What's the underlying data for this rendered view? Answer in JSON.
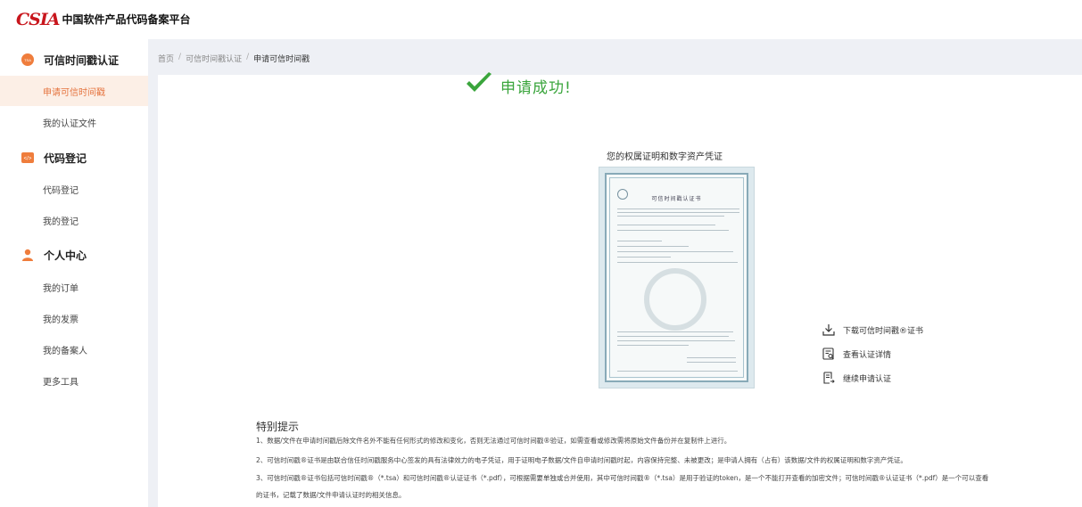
{
  "brand": {
    "mark": "CSIA",
    "name": "中国软件产品代码备案平台"
  },
  "sidebar": {
    "groups": [
      {
        "label": "可信时间戳认证",
        "icon": "tsa-icon",
        "items": [
          "申请可信时间戳",
          "我的认证文件"
        ]
      },
      {
        "label": "代码登记",
        "icon": "code-icon",
        "items": [
          "代码登记",
          "我的登记"
        ]
      },
      {
        "label": "个人中心",
        "icon": "user-icon",
        "items": [
          "我的订单",
          "我的发票",
          "我的备案人",
          "更多工具"
        ]
      }
    ],
    "tsa_badge": "TSA",
    "code_badge": "</>",
    "active_item": "申请可信时间戳"
  },
  "breadcrumb": {
    "home": "首页",
    "sep": "/",
    "parent": "可信时间戳认证",
    "current": "申请可信时间戳"
  },
  "result": {
    "title": "申请成功!",
    "subtitle": "您的权属证明和数字资产凭证"
  },
  "certificate": {
    "title": "可信时间戳认证书"
  },
  "actions": {
    "download": "下载可信时间戳®证书",
    "details": "查看认证详情",
    "continue": "继续申请认证"
  },
  "notice": {
    "title": "特别提示",
    "p1": "1、数据/文件在申请时间戳后除文件名外不能有任何形式的修改和变化，否则无法通过可信时间戳®验证，如需查看或修改需将原始文件备份并在复制件上进行。",
    "p2": "2、可信时间戳®证书是由联合信任时间戳服务中心签发的具有法律效力的电子凭证，用于证明电子数据/文件自申请时间戳时起，内容保持完整、未被更改；是申请人拥有（占有）该数据/文件的权属证明和数字资产凭证。",
    "p3": "3、可信时间戳®证书包括可信时间戳®（*.tsa）和可信时间戳®认证证书（*.pdf），可根据需要单独或合并使用，其中可信时间戳®（*.tsa）是用于验证的token，是一个不能打开查看的加密文件；可信时间戳®认证证书（*.pdf）是一个可以查看",
    "p4": "的证书，记载了数据/文件申请认证时的相关信息。"
  },
  "colors": {
    "accent": "#e5743f",
    "success": "#3aa53c",
    "brand_red": "#c8161d"
  }
}
